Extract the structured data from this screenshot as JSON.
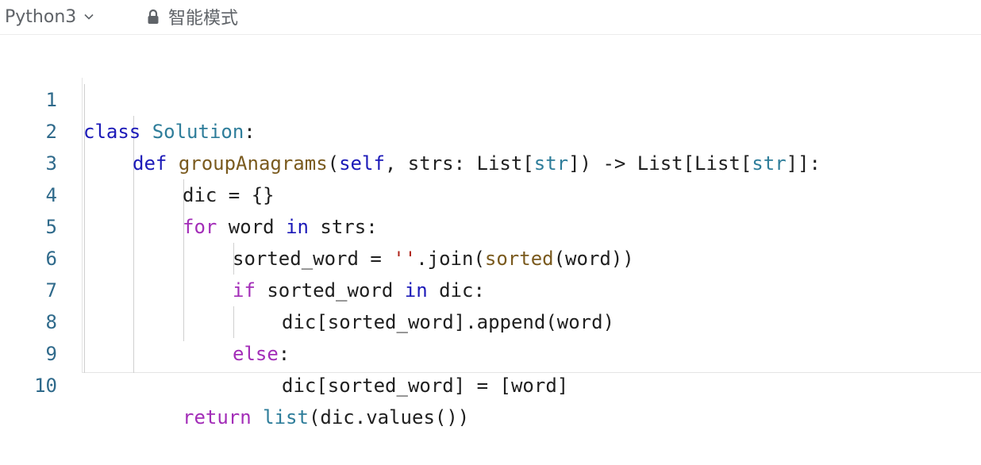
{
  "toolbar": {
    "language": "Python3",
    "mode": "智能模式",
    "icons": [
      "chevron-down-icon",
      "lock-icon"
    ]
  },
  "editor": {
    "lines": [
      {
        "number": "1"
      },
      {
        "number": "2"
      },
      {
        "number": "3"
      },
      {
        "number": "4"
      },
      {
        "number": "5"
      },
      {
        "number": "6"
      },
      {
        "number": "7"
      },
      {
        "number": "8"
      },
      {
        "number": "9"
      },
      {
        "number": "10"
      }
    ],
    "tokens": {
      "l1": [
        "class",
        "Solution",
        ":"
      ],
      "l2": [
        "def",
        "groupAnagrams",
        "(",
        "self",
        ", strs: List[",
        "str",
        "]) -> List[List[",
        "str",
        "]]:"
      ],
      "l3": [
        "dic = {}"
      ],
      "l4": [
        "for",
        " word ",
        "in",
        " strs:"
      ],
      "l5": [
        "sorted_word = ",
        "''",
        ".join(",
        "sorted",
        "(word))"
      ],
      "l6": [
        "if",
        " sorted_word ",
        "in",
        " dic:"
      ],
      "l7": [
        "dic[sorted_word].append(word)"
      ],
      "l8": [
        "else",
        ":"
      ],
      "l9": [
        "dic[sorted_word] = [word]"
      ],
      "l10": [
        "return",
        " ",
        "list",
        "(dic.values())"
      ]
    }
  },
  "colors": {
    "keyword_blue": "#1c1ab8",
    "keyword_purple": "#a32db8",
    "class_teal": "#2e7d9a",
    "function_brown": "#7a5a1e",
    "string_red": "#b0261b",
    "line_number": "#2f6a8b"
  }
}
